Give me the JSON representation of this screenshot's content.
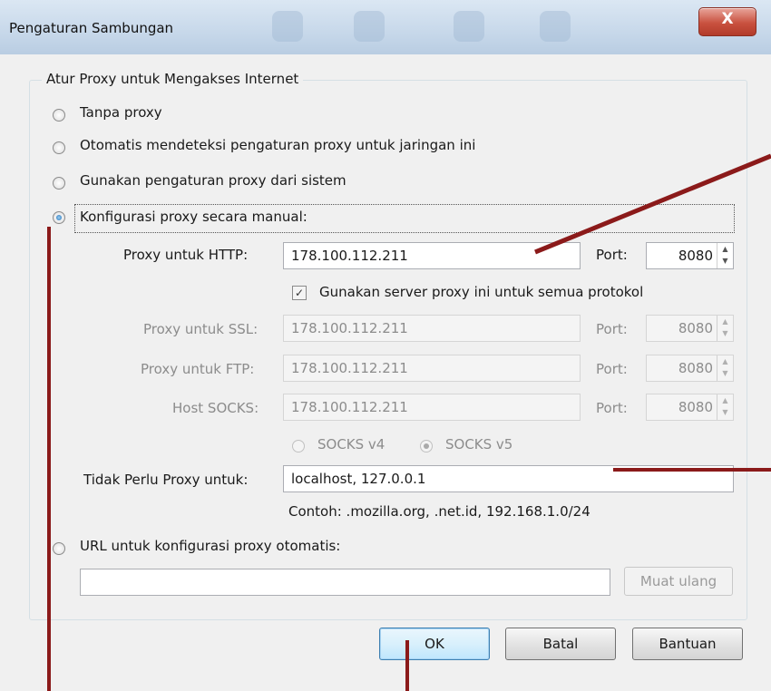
{
  "window": {
    "title": "Pengaturan Sambungan",
    "close_glyph": "X"
  },
  "group": {
    "legend": "Atur Proxy untuk Mengakses Internet"
  },
  "options": {
    "no_proxy": "Tanpa proxy",
    "auto_detect": "Otomatis mendeteksi pengaturan proxy untuk jaringan ini",
    "system": "Gunakan pengaturan proxy dari sistem",
    "manual": "Konfigurasi proxy secara manual:",
    "pac_url": "URL untuk konfigurasi proxy otomatis:"
  },
  "http": {
    "label": "Proxy untuk HTTP:",
    "value": "178.100.112.211",
    "port_label": "Port:",
    "port": "8080"
  },
  "share_checkbox": {
    "label": "Gunakan server proxy ini untuk semua protokol",
    "checked": true
  },
  "ssl": {
    "label": "Proxy untuk SSL:",
    "value": "178.100.112.211",
    "port_label": "Port:",
    "port": "8080"
  },
  "ftp": {
    "label": "Proxy untuk FTP:",
    "value": "178.100.112.211",
    "port_label": "Port:",
    "port": "8080"
  },
  "socks": {
    "label": "Host SOCKS:",
    "value": "178.100.112.211",
    "port_label": "Port:",
    "port": "8080",
    "v4": "SOCKS v4",
    "v5": "SOCKS v5"
  },
  "no_proxy_for": {
    "label": "Tidak Perlu Proxy untuk:",
    "value": "localhost, 127.0.0.1",
    "example": "Contoh: .mozilla.org, .net.id, 192.168.1.0/24"
  },
  "pac": {
    "value": "",
    "reload_label": "Muat ulang"
  },
  "buttons": {
    "ok": "OK",
    "cancel": "Batal",
    "help": "Bantuan"
  },
  "colors": {
    "annotation": "#8b1a1a",
    "titlebar": "#c7d8ea",
    "close": "#c9513f"
  }
}
